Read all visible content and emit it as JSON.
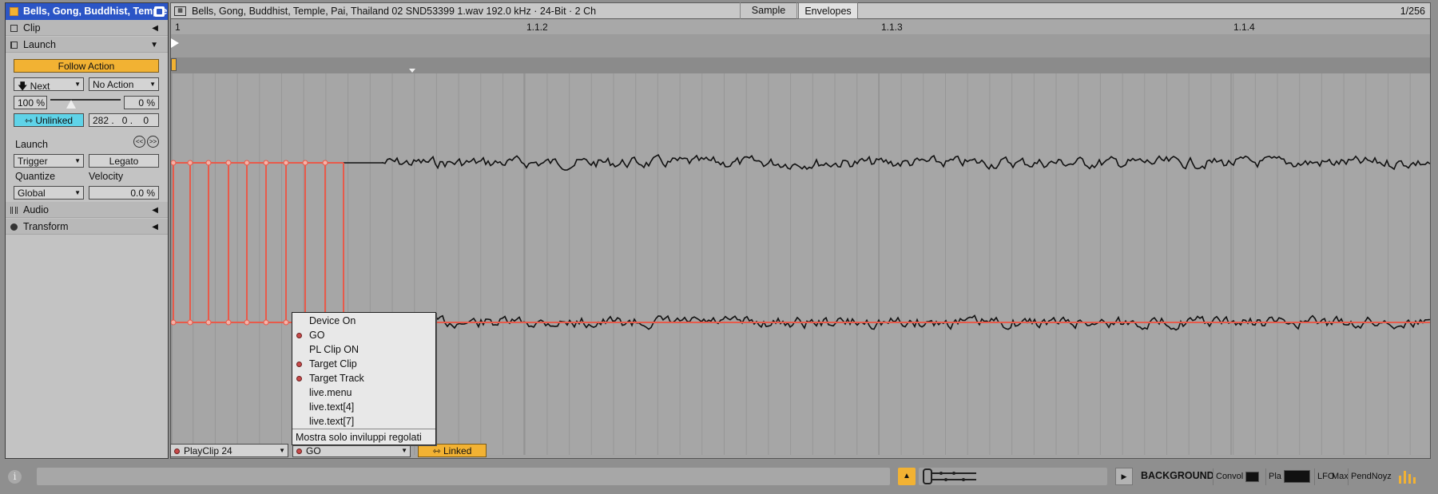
{
  "clip": {
    "title": "Bells, Gong, Buddhist, Temple, Pai, Thailand 02 SND53399 1.wav",
    "color": "#f2b233"
  },
  "sections": {
    "clip": "Clip",
    "launch": "Launch",
    "audio": "Audio",
    "transform": "Transform"
  },
  "follow_action": {
    "label": "Follow Action",
    "action_a": "Next",
    "action_b": "No Action",
    "chance_a": "100 %",
    "chance_b": "0 %",
    "chance_ratio": 0.3,
    "link_label": "Unlinked",
    "time": [
      "282 .",
      "0 .",
      "0"
    ]
  },
  "launch": {
    "label": "Launch",
    "mode": "Trigger",
    "legato": "Legato",
    "quantize_label": "Quantize",
    "quantize_value": "Global",
    "velocity_label": "Velocity",
    "velocity_value": "0.0 %"
  },
  "topbar": {
    "file_info": "Bells, Gong, Buddhist, Temple, Pai, Thailand 02 SND53399 1.wav  192.0 kHz · 24-Bit · 2 Ch",
    "tab_sample": "Sample",
    "tab_envelopes": "Envelopes",
    "grid": "1/256"
  },
  "ruler": {
    "labels": [
      "1",
      "1.1.2",
      "1.1.3",
      "1.1.4"
    ]
  },
  "envelope": {
    "device": "PlayClip 24",
    "parameter": "GO",
    "linked": "Linked"
  },
  "menu": {
    "items": [
      {
        "label": "Device On",
        "mapped": false
      },
      {
        "label": "GO",
        "mapped": true
      },
      {
        "label": "PL Clip ON",
        "mapped": false
      },
      {
        "label": "Target Clip",
        "mapped": true
      },
      {
        "label": "Target Track",
        "mapped": true
      },
      {
        "label": "live.menu",
        "mapped": false
      },
      {
        "label": "live.text[4]",
        "mapped": false
      },
      {
        "label": "live.text[7]",
        "mapped": false
      }
    ],
    "footer": "Mostra solo inviluppi regolati"
  },
  "status": {
    "info_icon": "i",
    "devices": [
      "BACKGROUND",
      "Convol",
      "Pla",
      "LFO",
      "Max",
      "PendNoyz"
    ]
  },
  "colors": {
    "accent": "#f2b233",
    "envelope": "#e85a4a",
    "title_bar": "#2b55c6",
    "unlinked": "#5fd3e8"
  }
}
